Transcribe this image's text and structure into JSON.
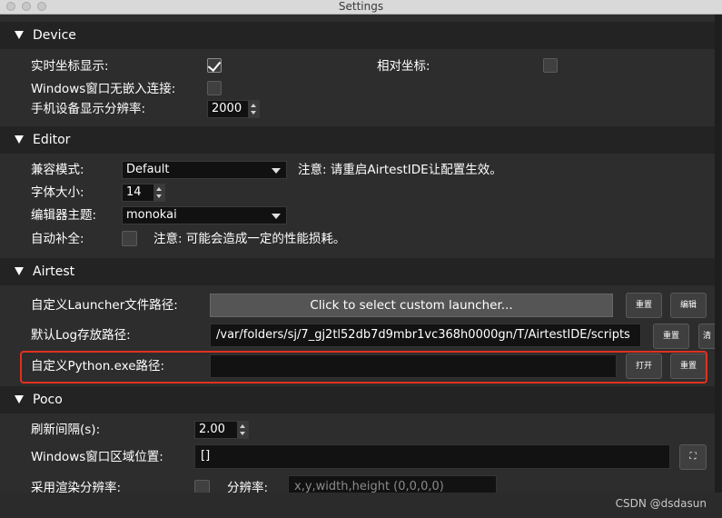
{
  "window": {
    "title": "Settings"
  },
  "sections": {
    "device": {
      "title": "Device",
      "realtime_coords_label": "实时坐标显示:",
      "realtime_coords_checked": true,
      "relative_coords_label": "相对坐标:",
      "relative_coords_checked": false,
      "windows_no_embed_label": "Windows窗口无嵌入连接:",
      "windows_no_embed_checked": false,
      "resolution_label": "手机设备显示分辨率:",
      "resolution_value": "2000"
    },
    "editor": {
      "title": "Editor",
      "compat_label": "兼容模式:",
      "compat_value": "Default",
      "compat_note": "注意: 请重启AirtestIDE让配置生效。",
      "font_size_label": "字体大小:",
      "font_size_value": "14",
      "theme_label": "编辑器主题:",
      "theme_value": "monokai",
      "autocomplete_label": "自动补全:",
      "autocomplete_checked": false,
      "autocomplete_note": "注意: 可能会造成一定的性能损耗。"
    },
    "airtest": {
      "title": "Airtest",
      "launcher_label": "自定义Launcher文件路径:",
      "launcher_button": "Click to select custom launcher...",
      "launcher_reset": "重置",
      "launcher_edit": "编辑",
      "log_label": "默认Log存放路径:",
      "log_value": "/var/folders/sj/7_gj2tl52db7d9mbr1vc368h0000gn/T/AirtestIDE/scripts",
      "log_reset": "重置",
      "log_clear_partial": "清",
      "python_label": "自定义Python.exe路径:",
      "python_value": "",
      "python_open": "打开",
      "python_reset": "重置"
    },
    "poco": {
      "title": "Poco",
      "refresh_label": "刷新间隔(s):",
      "refresh_value": "2.00",
      "window_region_label": "Windows窗口区域位置:",
      "window_region_value": "[]",
      "render_res_label": "采用渲染分辨率:",
      "render_res_checked": false,
      "resolution_label": "分辨率:",
      "resolution_placeholder": "x,y,width,height (0,0,0,0)"
    }
  },
  "watermark": "CSDN @dsdasun",
  "colors": {
    "highlight": "#e0311f",
    "background": "#2d2d2d",
    "section_header": "#232323"
  }
}
